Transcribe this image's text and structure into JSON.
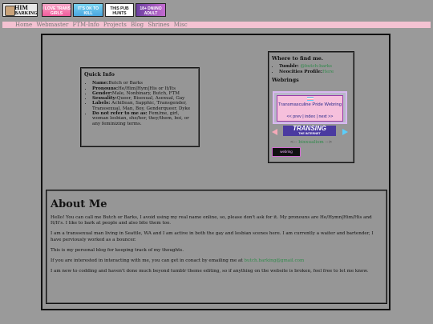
{
  "badges": [
    {
      "text": "HIM",
      "sub": "BARKING",
      "icon": "dog-face-icon"
    },
    {
      "text": "I LOVE TRANS GIRLS"
    },
    {
      "text": "IT'S OK TO KILL"
    },
    {
      "text": "THIS PUB HUNTS TERFS"
    },
    {
      "text": "18+ DNI/NO ADULT"
    }
  ],
  "nav": [
    "Home",
    "Webmaster",
    "FTM-Info",
    "Projects",
    "Blog",
    "Shrines",
    "Misc"
  ],
  "quick_info": {
    "title": "Quick Info",
    "items": [
      {
        "label": "Name:",
        "value": "Butch or Barks"
      },
      {
        "label": "Pronouns:",
        "value": "He/Him|Hym|His or It/Its"
      },
      {
        "label": "Gender:",
        "value": "Male, Nonbinary, Butch, FTM"
      },
      {
        "label": "Sexuality:",
        "value": "Queer, Bisexual, Asexual, Gay"
      },
      {
        "label": "Labels:",
        "value": "Achillean, Sapphic, Transgender, Transsexual, Man, Boy, Genderqueer, Dyke"
      },
      {
        "label": "Do not refer to me as:",
        "value": "Fem/me, girl, woman lesbian, she/her, they/them, boi, or any feminizing terms."
      }
    ]
  },
  "where": {
    "title": "Where to find me.",
    "items": [
      {
        "label": "Tumblr:",
        "value": "@butch-barks"
      },
      {
        "label": "Neocities Profile:",
        "value": "Here"
      }
    ],
    "webrings_title": "Webrings",
    "webring_name": "Transmasculine Pride Webring",
    "webring_nav": "<< prev | index | next >>",
    "transing_title": "TRANSING",
    "transing_sub": "THE INTERNET",
    "bixx": "bixxualism",
    "bixx_left": "<--",
    "bixx_right": "-->",
    "webring_button": "webring"
  },
  "about": {
    "title": "About Me",
    "paragraphs": [
      "Hello! You can call me Butch or Barks, I avoid using my real name online, so, please don't ask for it. My pronouns are He/Hymn|Him/His and It/It's. I like to bark at people and also bite them too.",
      "I am a transsexual man living in Seattle, WA and I am active in both the gay and lesbian scenes here. I am currently a waiter and bartender, I have perviously worked as a bouncer.",
      "This is my personal blog for keeping track of my thoughts.",
      "If you are interested in interacting with me, you can get in conact by emailing me at",
      "butch.barking@gmail.com",
      "I am new to codding and haven't done much beyond tumblr theme editing, so if anything on the website is broken, feel free to let me know."
    ]
  },
  "colors": {
    "background": "#9a9a9a",
    "nav_bar": "#f4c2d2",
    "link": "#2f8a4a"
  }
}
